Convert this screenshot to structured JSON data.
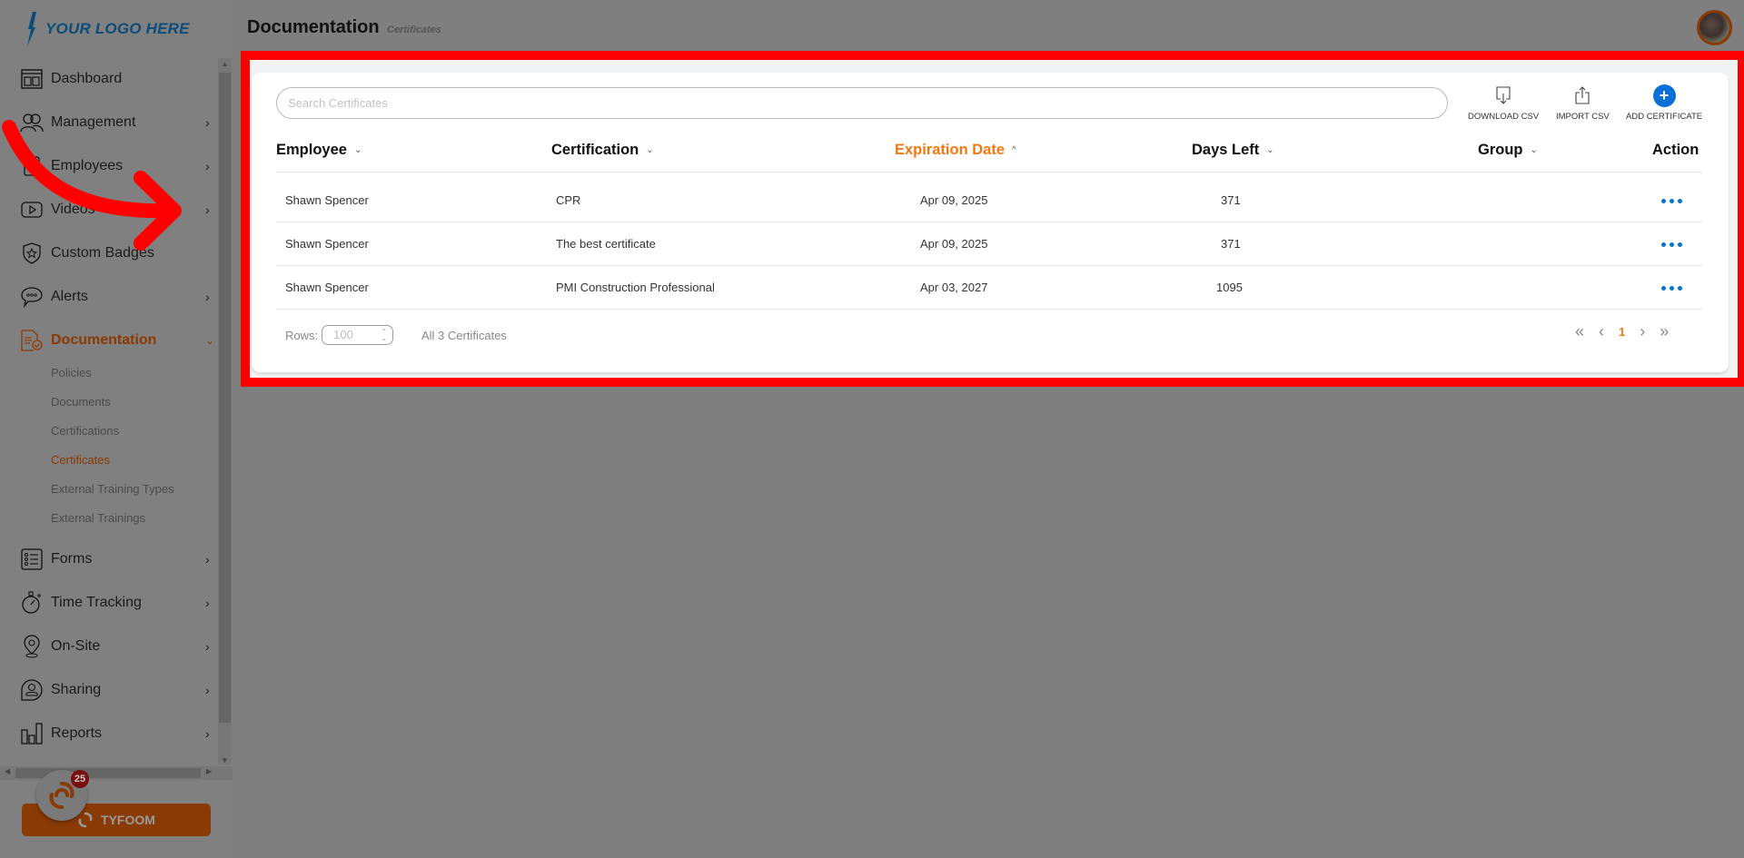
{
  "sidebar": {
    "logo_text": "YOUR LOGO HERE",
    "items": [
      {
        "label": "Dashboard",
        "icon": "dashboard-icon",
        "has_children": false
      },
      {
        "label": "Management",
        "icon": "people-icon",
        "has_children": true
      },
      {
        "label": "Employees",
        "icon": "id-badge-icon",
        "has_children": true
      },
      {
        "label": "Videos",
        "icon": "video-play-icon",
        "has_children": true
      },
      {
        "label": "Custom Badges",
        "icon": "shield-star-icon",
        "has_children": false
      },
      {
        "label": "Alerts",
        "icon": "chat-bubble-icon",
        "has_children": true
      },
      {
        "label": "Documentation",
        "icon": "document-check-icon",
        "has_children": true,
        "expanded": true,
        "active": true
      },
      {
        "label": "Forms",
        "icon": "list-icon",
        "has_children": true
      },
      {
        "label": "Time Tracking",
        "icon": "stopwatch-icon",
        "has_children": true
      },
      {
        "label": "On-Site",
        "icon": "location-pin-icon",
        "has_children": true
      },
      {
        "label": "Sharing",
        "icon": "user-share-icon",
        "has_children": true
      },
      {
        "label": "Reports",
        "icon": "bar-chart-icon",
        "has_children": true
      }
    ],
    "documentation_children": [
      {
        "label": "Policies"
      },
      {
        "label": "Documents"
      },
      {
        "label": "Certifications"
      },
      {
        "label": "Certificates",
        "active": true
      },
      {
        "label": "External Training Types"
      },
      {
        "label": "External Trainings"
      }
    ],
    "tyfoom_button": "TYFOOM",
    "notification_count": "25"
  },
  "header": {
    "title": "Documentation",
    "subtitle": "Certificates"
  },
  "toolbar": {
    "search_placeholder": "Search Certificates",
    "search_value": "",
    "download_label": "DOWNLOAD CSV",
    "import_label": "IMPORT CSV",
    "add_label": "ADD CERTIFICATE"
  },
  "table": {
    "columns": [
      {
        "label": "Employee",
        "sort": "none"
      },
      {
        "label": "Certification",
        "sort": "none"
      },
      {
        "label": "Expiration Date",
        "sort": "ascending"
      },
      {
        "label": "Days Left",
        "sort": "none"
      },
      {
        "label": "Group",
        "sort": "none"
      },
      {
        "label": "Action"
      }
    ],
    "rows": [
      {
        "employee": "Shawn Spencer",
        "certification": "CPR",
        "expiration": "Apr 09, 2025",
        "days_left": "371",
        "group": ""
      },
      {
        "employee": "Shawn Spencer",
        "certification": "The best certificate",
        "expiration": "Apr 09, 2025",
        "days_left": "371",
        "group": ""
      },
      {
        "employee": "Shawn Spencer",
        "certification": "PMI Construction Professional",
        "expiration": "Apr 03, 2027",
        "days_left": "1095",
        "group": ""
      }
    ]
  },
  "footer": {
    "rows_label": "Rows:",
    "rows_value": "100",
    "count_text": "All 3 Certificates",
    "current_page": "1"
  },
  "colors": {
    "accent_orange": "#f07a12",
    "active_nav": "#8a3a04",
    "action_blue": "#0a6fd6",
    "highlight_red": "#ff0000"
  }
}
